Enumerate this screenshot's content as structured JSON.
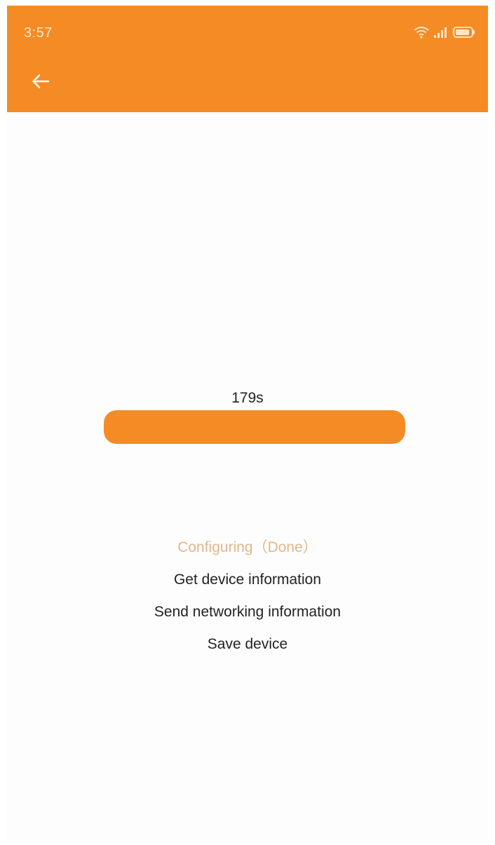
{
  "status_bar": {
    "time": "3:57",
    "icons": [
      "wifi-icon",
      "signal-icon",
      "battery-icon"
    ]
  },
  "toolbar": {
    "back_icon": "arrow-left-icon"
  },
  "progress": {
    "countdown": "179s",
    "fraction": 1.0
  },
  "steps": [
    {
      "label": "Configuring（Done）",
      "state": "done"
    },
    {
      "label": "Get device information",
      "state": "pending"
    },
    {
      "label": "Send networking information",
      "state": "pending"
    },
    {
      "label": "Save device",
      "state": "pending"
    }
  ],
  "colors": {
    "accent": "#f48b25",
    "active_step": "#e3b78a",
    "text": "#222222",
    "background": "#fdfdfd"
  }
}
